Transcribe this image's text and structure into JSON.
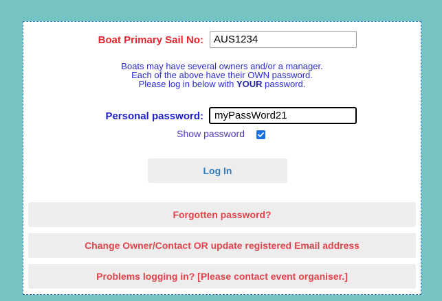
{
  "sail": {
    "label": "Boat Primary Sail No:",
    "value": "AUS1234"
  },
  "info": {
    "line1": "Boats may have several owners and/or a manager.",
    "line2": "Each of the above have their OWN password.",
    "line3_pre": "Please log in below with ",
    "line3_bold": "YOUR",
    "line3_post": " password."
  },
  "password": {
    "label": "Personal password:",
    "value": "myPassWord21"
  },
  "show_password": {
    "label": "Show password",
    "checked": true
  },
  "buttons": {
    "login": "Log In",
    "forgot": "Forgotten password?",
    "change": "Change Owner/Contact OR update registered Email address",
    "problems": "Problems logging in?   [Please contact event organiser.]"
  },
  "colors": {
    "background": "#76c3c3",
    "sail_label": "#e5242b",
    "password_label": "#2121c8",
    "info_text": "#2b2bd1",
    "login_text": "#2b7bbf",
    "wide_button_text": "#e4434a",
    "checkbox": "#1c6fe0"
  },
  "icons": {
    "checkbox": "checkmark-icon"
  }
}
